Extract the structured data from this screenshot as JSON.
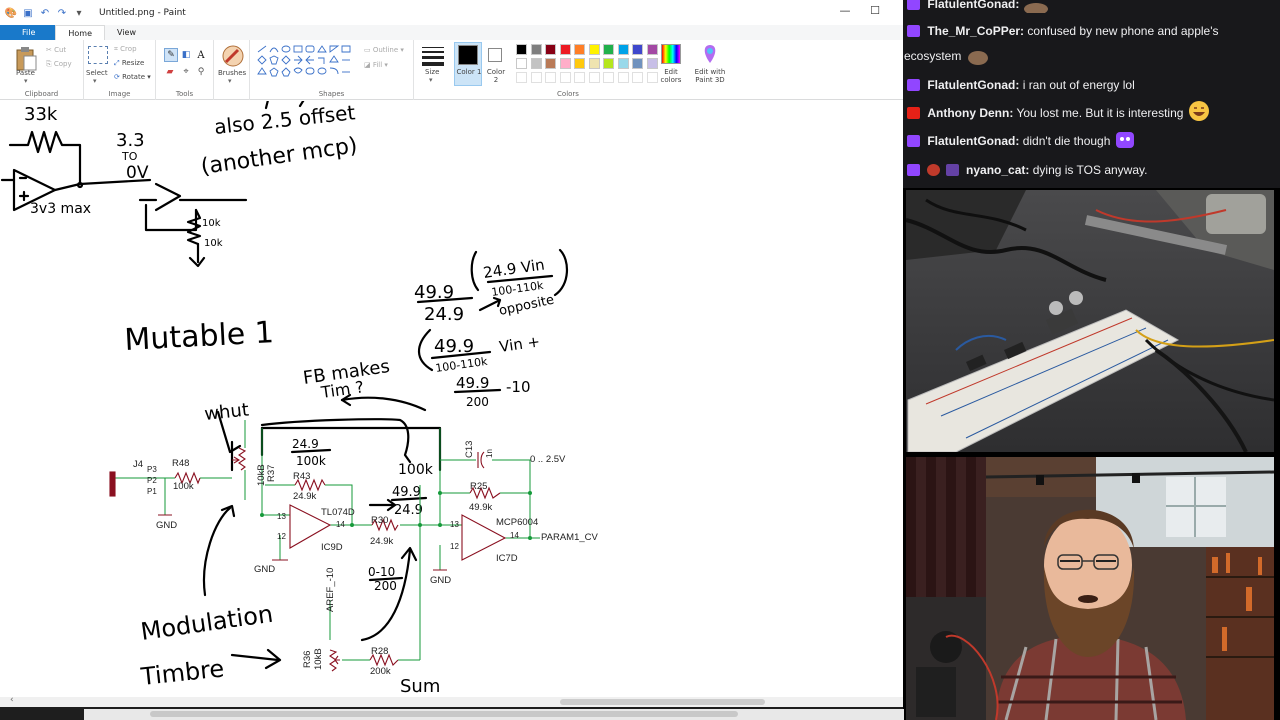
{
  "window": {
    "title": "Untitled.png - Paint",
    "controls": [
      "—",
      "☐"
    ]
  },
  "ribbon": {
    "tabs": [
      "File",
      "Home",
      "View"
    ],
    "clipboard": {
      "paste": "Paste",
      "cut": "Cut",
      "copy": "Copy",
      "label": "Clipboard"
    },
    "image": {
      "select": "Select",
      "crop": "Crop",
      "resize": "Resize",
      "rotate": "Rotate",
      "label": "Image"
    },
    "tools": {
      "label": "Tools",
      "brushes": "Brushes"
    },
    "shapes": {
      "outline": "Outline",
      "fill": "Fill",
      "label": "Shapes"
    },
    "size": {
      "label": "Size"
    },
    "color1": {
      "label": "Color 1",
      "value": "#000000"
    },
    "color2": {
      "label": "Color 2",
      "value": "#ffffff"
    },
    "colors": {
      "label": "Colors",
      "row1": [
        "#000000",
        "#7f7f7f",
        "#880015",
        "#ed1c24",
        "#ff7f27",
        "#fff200",
        "#22b14c",
        "#00a2e8",
        "#3f48cc",
        "#a349a4"
      ],
      "row2": [
        "#ffffff",
        "#c3c3c3",
        "#b97a57",
        "#ffaec9",
        "#ffc90e",
        "#efe4b0",
        "#b5e61d",
        "#99d9ea",
        "#7092be",
        "#c8bfe7"
      ]
    },
    "edit_colors": "Edit colors",
    "edit_3d": "Edit with Paint 3D"
  },
  "canvas": {
    "notes": {
      "r33k": "33k",
      "v33": "3.3",
      "to": "TO",
      "ov": "0V",
      "max": "3v3 max",
      "also": "also 2.5 offset",
      "another": "(another mcp)",
      "k10a": "10k",
      "k10b": "10k",
      "mutable": "Mutable 1",
      "fb": "FB makes",
      "tim": "Tim ?",
      "whut": "whut",
      "frac1_top": "24.9",
      "frac1_bot": "100k",
      "hundredk": "100k",
      "eq1_top": "49.9",
      "eq1_bot": "24.9",
      "eq1_inner_top": "24.9 Vin",
      "eq1_inner_bot": "100-110k",
      "opposite": "opposite",
      "eq2_top": "49.9",
      "eq2_bot": "100-110k",
      "eq2_vin": "Vin +",
      "eq3_top": "49.9",
      "eq3_bot": "200",
      "eq3_tail": "-10",
      "frac_mid_top": "49.9",
      "frac_mid_bot": "24.9",
      "zero10_top": "0-10",
      "zero10_bot": "200",
      "modulation": "Modulation",
      "timbre": "Timbre",
      "sum": "Sum"
    },
    "schematic": {
      "j4": "J4",
      "p3": "P3",
      "p2": "P2",
      "p1": "P1",
      "r48": "R48",
      "r48v": "100k",
      "gnd1": "GND",
      "r37": "R37",
      "r37v": "10kB",
      "r43": "R43",
      "r43v": "24.9k",
      "ic9": "TL074D",
      "ic9d": "IC9D",
      "pin14a": "14",
      "pin13a": "13",
      "pin12a": "12",
      "gnd2": "GND",
      "r30": "R30",
      "r30v": "24.9k",
      "c13": "C13",
      "c13v": "1n",
      "range": "0 .. 2.5V",
      "r25": "R25",
      "r25v": "49.9k",
      "mcp": "MCP6004",
      "ic7d": "IC7D",
      "pin13b": "13",
      "pin14b": "14",
      "pin12b": "12",
      "param": "PARAM1_CV",
      "gnd3": "GND",
      "aref": "AREF_-10",
      "r36": "R36",
      "r36v": "10kB",
      "r28": "R28",
      "r28v": "200k"
    }
  },
  "chat": {
    "messages": [
      {
        "user": "FlatulentGonad:",
        "text": "",
        "user_color": "#ffffff"
      },
      {
        "user": "The_Mr_CoPPer:",
        "text": "confused by new phone and apple's",
        "user_color": "#ffffff"
      },
      {
        "user": "",
        "text": "ecosystem",
        "user_color": "#ffffff"
      },
      {
        "user": "FlatulentGonad:",
        "text": "i ran out of energy lol",
        "user_color": "#ffffff"
      },
      {
        "user": "Anthony Denn:",
        "text": "You lost me. But it is interesting",
        "user_color": "#ffffff"
      },
      {
        "user": "FlatulentGonad:",
        "text": "didn't die though",
        "user_color": "#ffffff"
      },
      {
        "user": "nyano_cat:",
        "text": "dying is TOS anyway.",
        "user_color": "#ffffff"
      }
    ]
  }
}
